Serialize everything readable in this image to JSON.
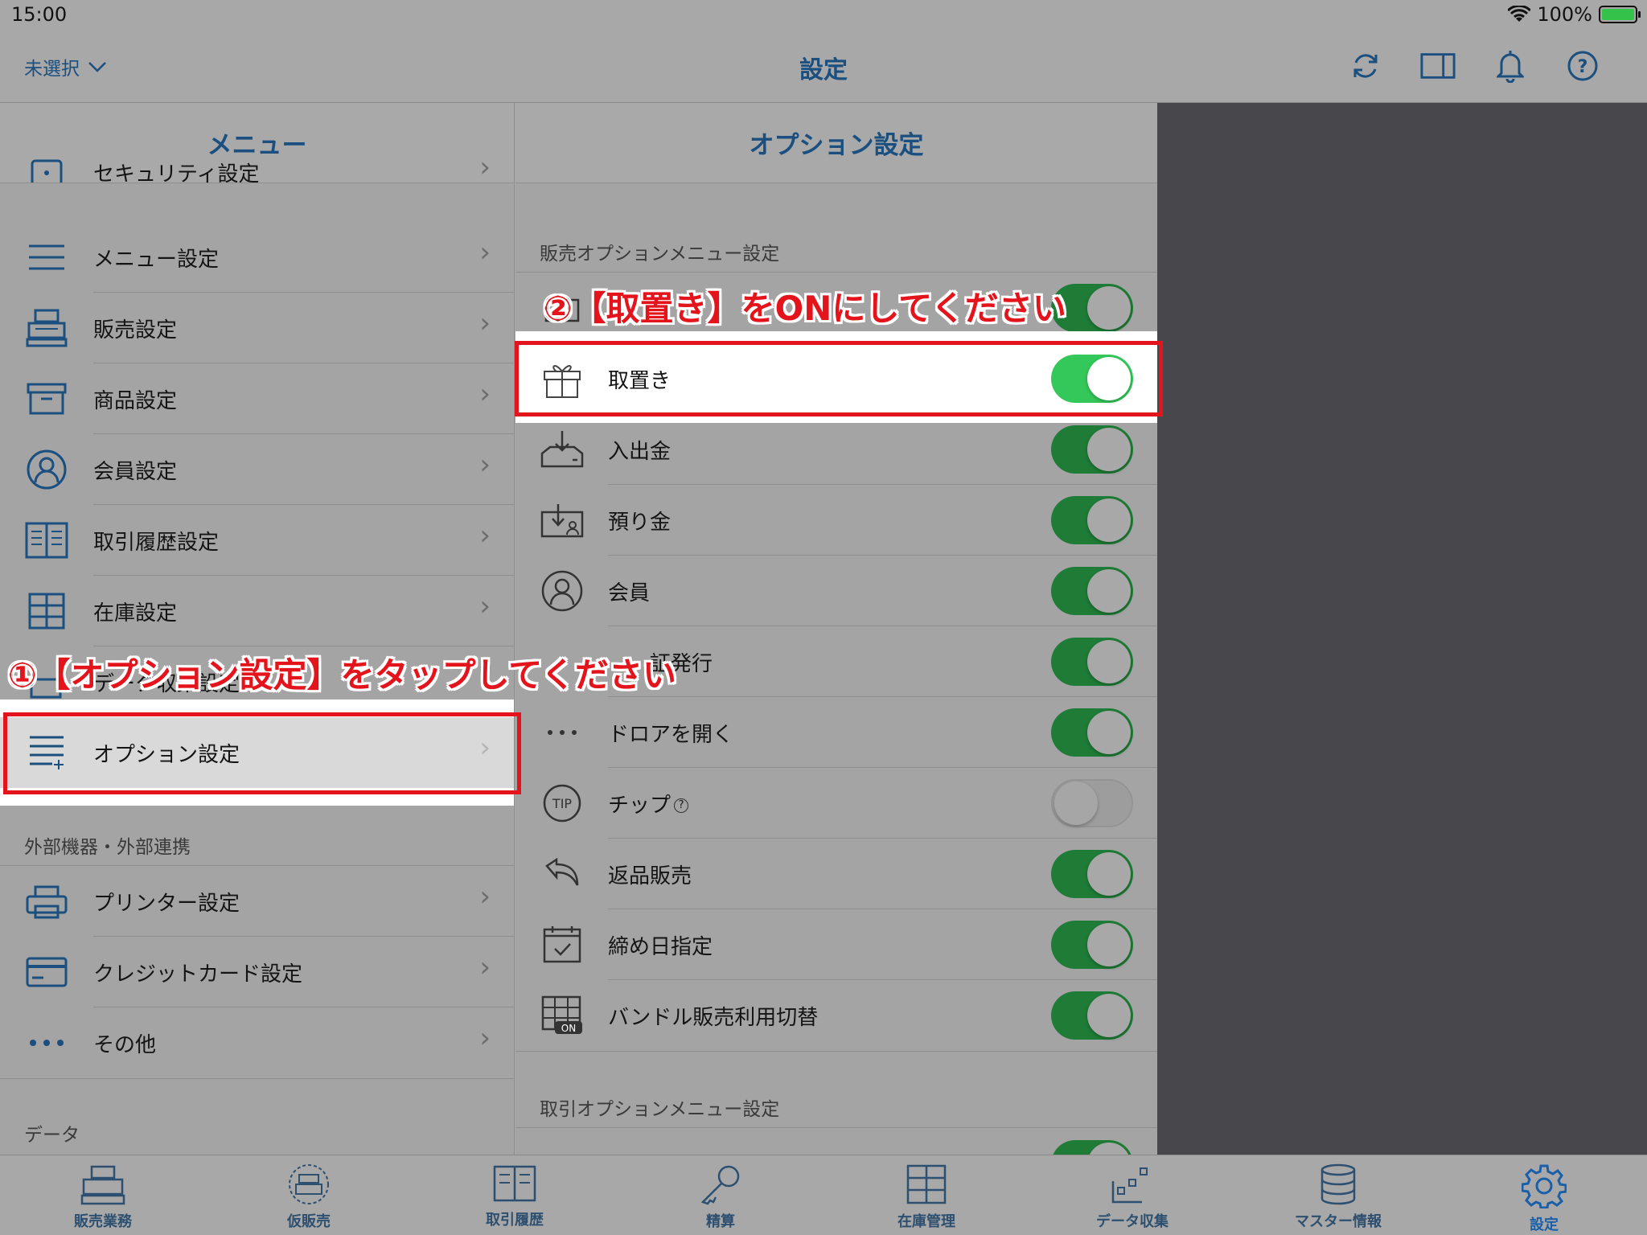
{
  "status_bar": {
    "time": "15:00",
    "battery": "100%"
  },
  "nav": {
    "left_label": "未選択",
    "title": "設定"
  },
  "left_pane": {
    "title": "メニュー",
    "items": [
      {
        "label": "セキュリティ設定",
        "icon": "lock-icon"
      },
      {
        "label": "メニュー設定",
        "icon": "menu-icon"
      },
      {
        "label": "販売設定",
        "icon": "register-icon"
      },
      {
        "label": "商品設定",
        "icon": "box-icon"
      },
      {
        "label": "会員設定",
        "icon": "member-icon"
      },
      {
        "label": "取引履歴設定",
        "icon": "book-icon"
      },
      {
        "label": "在庫設定",
        "icon": "shelf-icon"
      },
      {
        "label": "データ収集設定",
        "icon": "data-icon"
      },
      {
        "label": "オプション設定",
        "icon": "option-list-icon"
      }
    ],
    "section_external": "外部機器・外部連携",
    "external_items": [
      {
        "label": "プリンター設定",
        "icon": "printer-icon"
      },
      {
        "label": "クレジットカード設定",
        "icon": "credit-card-icon"
      },
      {
        "label": "その他",
        "icon": "more-icon"
      }
    ],
    "section_data": "データ"
  },
  "mid_pane": {
    "title": "オプション設定",
    "section_sales": "販売オプションメニュー設定",
    "options": [
      {
        "label": "",
        "on": true
      },
      {
        "label": "取置き",
        "on": true
      },
      {
        "label": "入出金",
        "on": true
      },
      {
        "label": "預り金",
        "on": true
      },
      {
        "label": "会員",
        "on": true
      },
      {
        "label": "証発行",
        "on": true
      },
      {
        "label": "ドロアを開く",
        "on": true
      },
      {
        "label": "チップ",
        "on": false,
        "help": "?"
      },
      {
        "label": "返品販売",
        "on": true
      },
      {
        "label": "締め日指定",
        "on": true
      },
      {
        "label": "バンドル販売利用切替",
        "on": true
      }
    ],
    "bundle_badge": "ON",
    "tip_badge": "TIP",
    "section_trade": "取引オプションメニュー設定"
  },
  "annotations": {
    "step1": "①【オプション設定】をタップしてください",
    "step2": "②【取置き】をONにしてください"
  },
  "tabs": [
    {
      "label": "販売業務"
    },
    {
      "label": "仮販売"
    },
    {
      "label": "取引履歴"
    },
    {
      "label": "精算"
    },
    {
      "label": "在庫管理"
    },
    {
      "label": "データ収集"
    },
    {
      "label": "マスター情報"
    },
    {
      "label": "設定"
    }
  ],
  "colors": {
    "accent": "#1b4f80",
    "toggle_on": "#34c759",
    "highlight_red": "#e3141b",
    "dark_pane": "#48484c"
  }
}
